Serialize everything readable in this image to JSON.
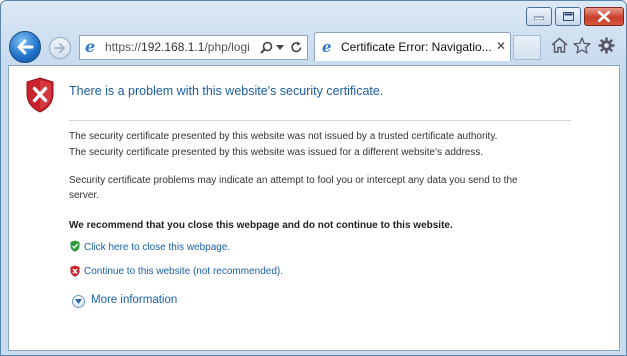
{
  "titlebar": {
    "minimize_icon": "minimize-icon",
    "maximize_icon": "maximize-icon",
    "close_icon": "close-icon"
  },
  "nav": {
    "address": {
      "protocol": "https://",
      "host": "192.168.1.1",
      "path": "/php/logi",
      "search_icon": "search-icon",
      "dropdown_icon": "chevron-down-icon",
      "refresh_icon": "refresh-icon"
    },
    "tab": {
      "title": "Certificate Error: Navigatio...",
      "close": "✕"
    },
    "tools": [
      "home-icon",
      "favorites-star-icon",
      "settings-gear-icon"
    ]
  },
  "page": {
    "heading": "There is a problem with this website's security certificate.",
    "details": [
      "The security certificate presented by this website was not issued by a trusted certificate authority.",
      "The security certificate presented by this website was issued for a different website's address."
    ],
    "warning_line1": "Security certificate problems may indicate an attempt to fool you or intercept any data you send to the",
    "warning_line2": "server.",
    "recommendation": "We recommend that you close this webpage and do not continue to this website.",
    "close_link": "Click here to close this webpage.",
    "continue_link": "Continue to this website (not recommended).",
    "more_info": "More information"
  },
  "colors": {
    "link": "#1a5fa8",
    "heading": "#1b5c9e",
    "danger": "#c8232c",
    "safe": "#2e9b3a"
  }
}
